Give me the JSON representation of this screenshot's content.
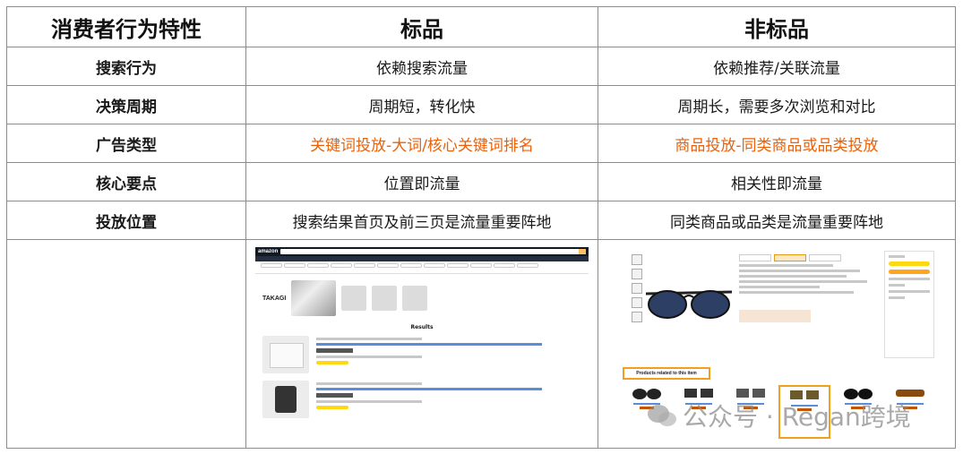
{
  "table": {
    "headers": [
      "消费者行为特性",
      "标品",
      "非标品"
    ],
    "rows": [
      {
        "label": "搜索行为",
        "standard": "依赖搜索流量",
        "nonstandard": "依赖推荐/关联流量",
        "highlight": false
      },
      {
        "label": "决策周期",
        "standard": "周期短，转化快",
        "nonstandard": "周期长，需要多次浏览和对比",
        "highlight": false
      },
      {
        "label": "广告类型",
        "standard": "关键词投放-大词/核心关键词排名",
        "nonstandard": "商品投放-同类商品或品类投放",
        "highlight": true
      },
      {
        "label": "核心要点",
        "standard": "位置即流量",
        "nonstandard": "相关性即流量",
        "highlight": false
      },
      {
        "label": "投放位置",
        "standard": "搜索结果首页及前三页是流量重要阵地",
        "nonstandard": "同类商品或品类是流量重要阵地",
        "highlight": false
      }
    ]
  },
  "screenshots": {
    "left": {
      "logo": "amazon",
      "brand": "TAKAGI",
      "results_title": "Results"
    },
    "right": {
      "related_title": "Products related to this item"
    }
  },
  "watermark": "公众号 · Regan跨境",
  "colors": {
    "highlight": "#e8620c",
    "border": "#8c8c8c",
    "amazon_dark": "#131921",
    "amazon_orange": "#f0a11c"
  }
}
